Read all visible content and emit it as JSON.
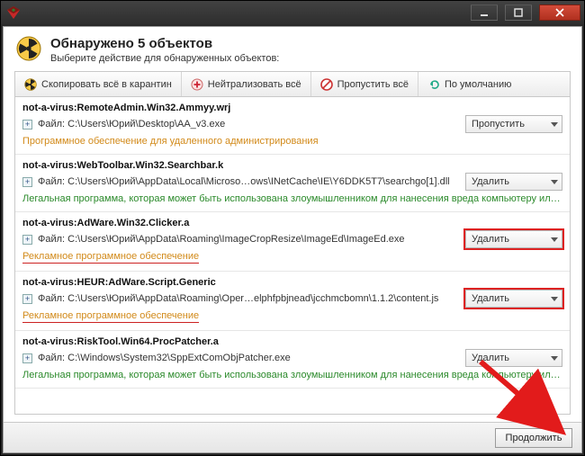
{
  "titlebar": {
    "title": ""
  },
  "header": {
    "title": "Обнаружено 5 объектов",
    "subtitle": "Выберите действие для обнаруженных объектов:"
  },
  "toolbar": {
    "quarantine_all": "Скопировать всё в карантин",
    "neutralize_all": "Нейтрализовать всё",
    "skip_all": "Пропустить всё",
    "default": "По умолчанию"
  },
  "labels": {
    "file_prefix": "Файл:"
  },
  "items": [
    {
      "name": "not-a-virus:RemoteAdmin.Win32.Ammyy.wrj",
      "path": "C:\\Users\\Юрий\\Desktop\\AA_v3.exe",
      "action": "Пропустить",
      "description": "Программное обеспечение для удаленного администрирования",
      "desc_style": "orange",
      "highlight": false,
      "underlined": false
    },
    {
      "name": "not-a-virus:WebToolbar.Win32.Searchbar.k",
      "path": "C:\\Users\\Юрий\\AppData\\Local\\Microso…ows\\INetCache\\IE\\Y6DDK5T7\\searchgo[1].dll",
      "action": "Удалить",
      "description": "Легальная программа, которая может быть использована злоумышленником для нанесения вреда компьютеру ил…",
      "desc_style": "green",
      "highlight": false,
      "underlined": false
    },
    {
      "name": "not-a-virus:AdWare.Win32.Clicker.a",
      "path": "C:\\Users\\Юрий\\AppData\\Roaming\\ImageCropResize\\ImageEd\\ImageEd.exe",
      "action": "Удалить",
      "description": "Рекламное программное обеспечение",
      "desc_style": "orange",
      "highlight": true,
      "underlined": true
    },
    {
      "name": "not-a-virus:HEUR:AdWare.Script.Generic",
      "path": "C:\\Users\\Юрий\\AppData\\Roaming\\Oper…elphfpbjnead\\jcchmcbomn\\1.1.2\\content.js",
      "action": "Удалить",
      "description": "Рекламное программное обеспечение",
      "desc_style": "orange",
      "highlight": true,
      "underlined": true
    },
    {
      "name": "not-a-virus:RiskTool.Win64.ProcPatcher.a",
      "path": "C:\\Windows\\System32\\SppExtComObjPatcher.exe",
      "action": "Удалить",
      "description": "Легальная программа, которая может быть использована злоумышленником для нанесения вреда компьютеру ил…",
      "desc_style": "green",
      "highlight": false,
      "underlined": false
    }
  ],
  "footer": {
    "continue": "Продолжить"
  }
}
